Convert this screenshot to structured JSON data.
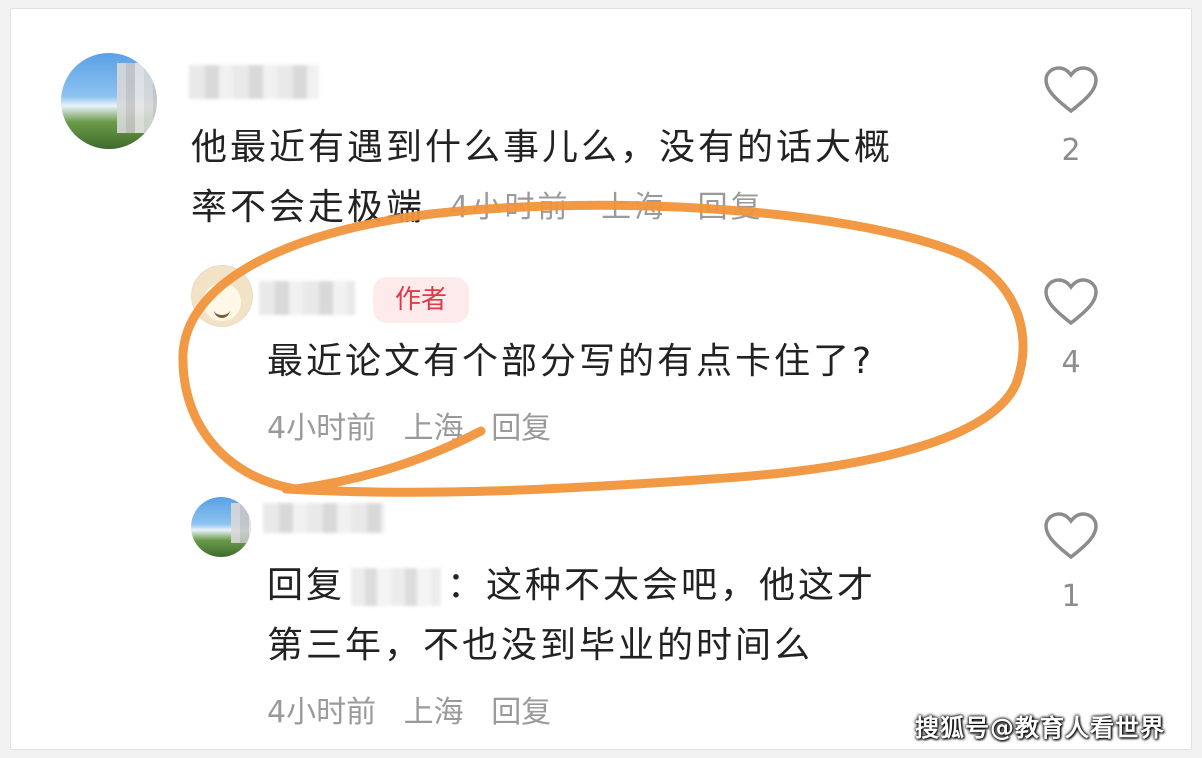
{
  "comments": [
    {
      "text_line1": "他最近有遇到什么事儿么，没有的话大概",
      "text_line2": "率不会走极端",
      "time": "4小时前",
      "location": "上海",
      "reply_label": "回复",
      "likes": "2"
    },
    {
      "badge": "作者",
      "text_line1": "最近论文有个部分写的有点卡住了?",
      "time": "4小时前",
      "location": "上海",
      "reply_label": "回复",
      "likes": "4"
    },
    {
      "reply_prefix": "回复",
      "text_line1_rest": "：这种不太会吧，他这才",
      "text_line2": "第三年，不也没到毕业的时间么",
      "time": "4小时前",
      "location": "上海",
      "reply_label": "回复",
      "likes": "1"
    }
  ],
  "watermark": "搜狐号@教育人看世界",
  "colors": {
    "annotation": "#f0933a",
    "author_badge_text": "#e0394a",
    "author_badge_bg": "#fdeaea",
    "meta_text": "#9a9a9a"
  },
  "icons": {
    "like": "heart-outline-icon"
  }
}
